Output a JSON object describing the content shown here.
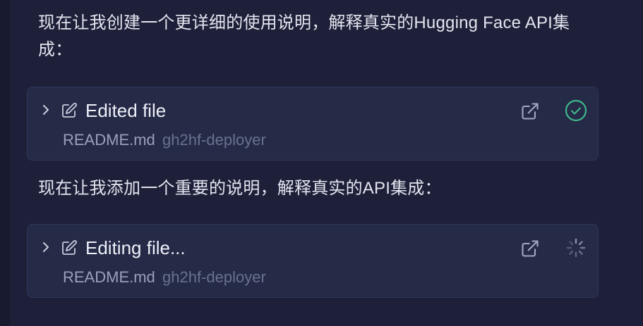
{
  "messages": [
    {
      "text": "现在让我创建一个更详细的使用说明，解释真实的Hugging Face API集成："
    },
    {
      "text": "现在让我添加一个重要的说明，解释真实的API集成："
    }
  ],
  "cards": [
    {
      "title": "Edited file",
      "file": "README.md",
      "repo": "gh2hf-deployer",
      "status": "done",
      "status_icon": "check-circle-icon",
      "status_color": "#3fb68b"
    },
    {
      "title": "Editing file...",
      "file": "README.md",
      "repo": "gh2hf-deployer",
      "status": "in-progress",
      "status_icon": "spinner-icon",
      "status_color": "#8a90a8"
    }
  ],
  "colors": {
    "background": "#1d2038",
    "card": "#252a47",
    "success": "#3fb68b"
  }
}
